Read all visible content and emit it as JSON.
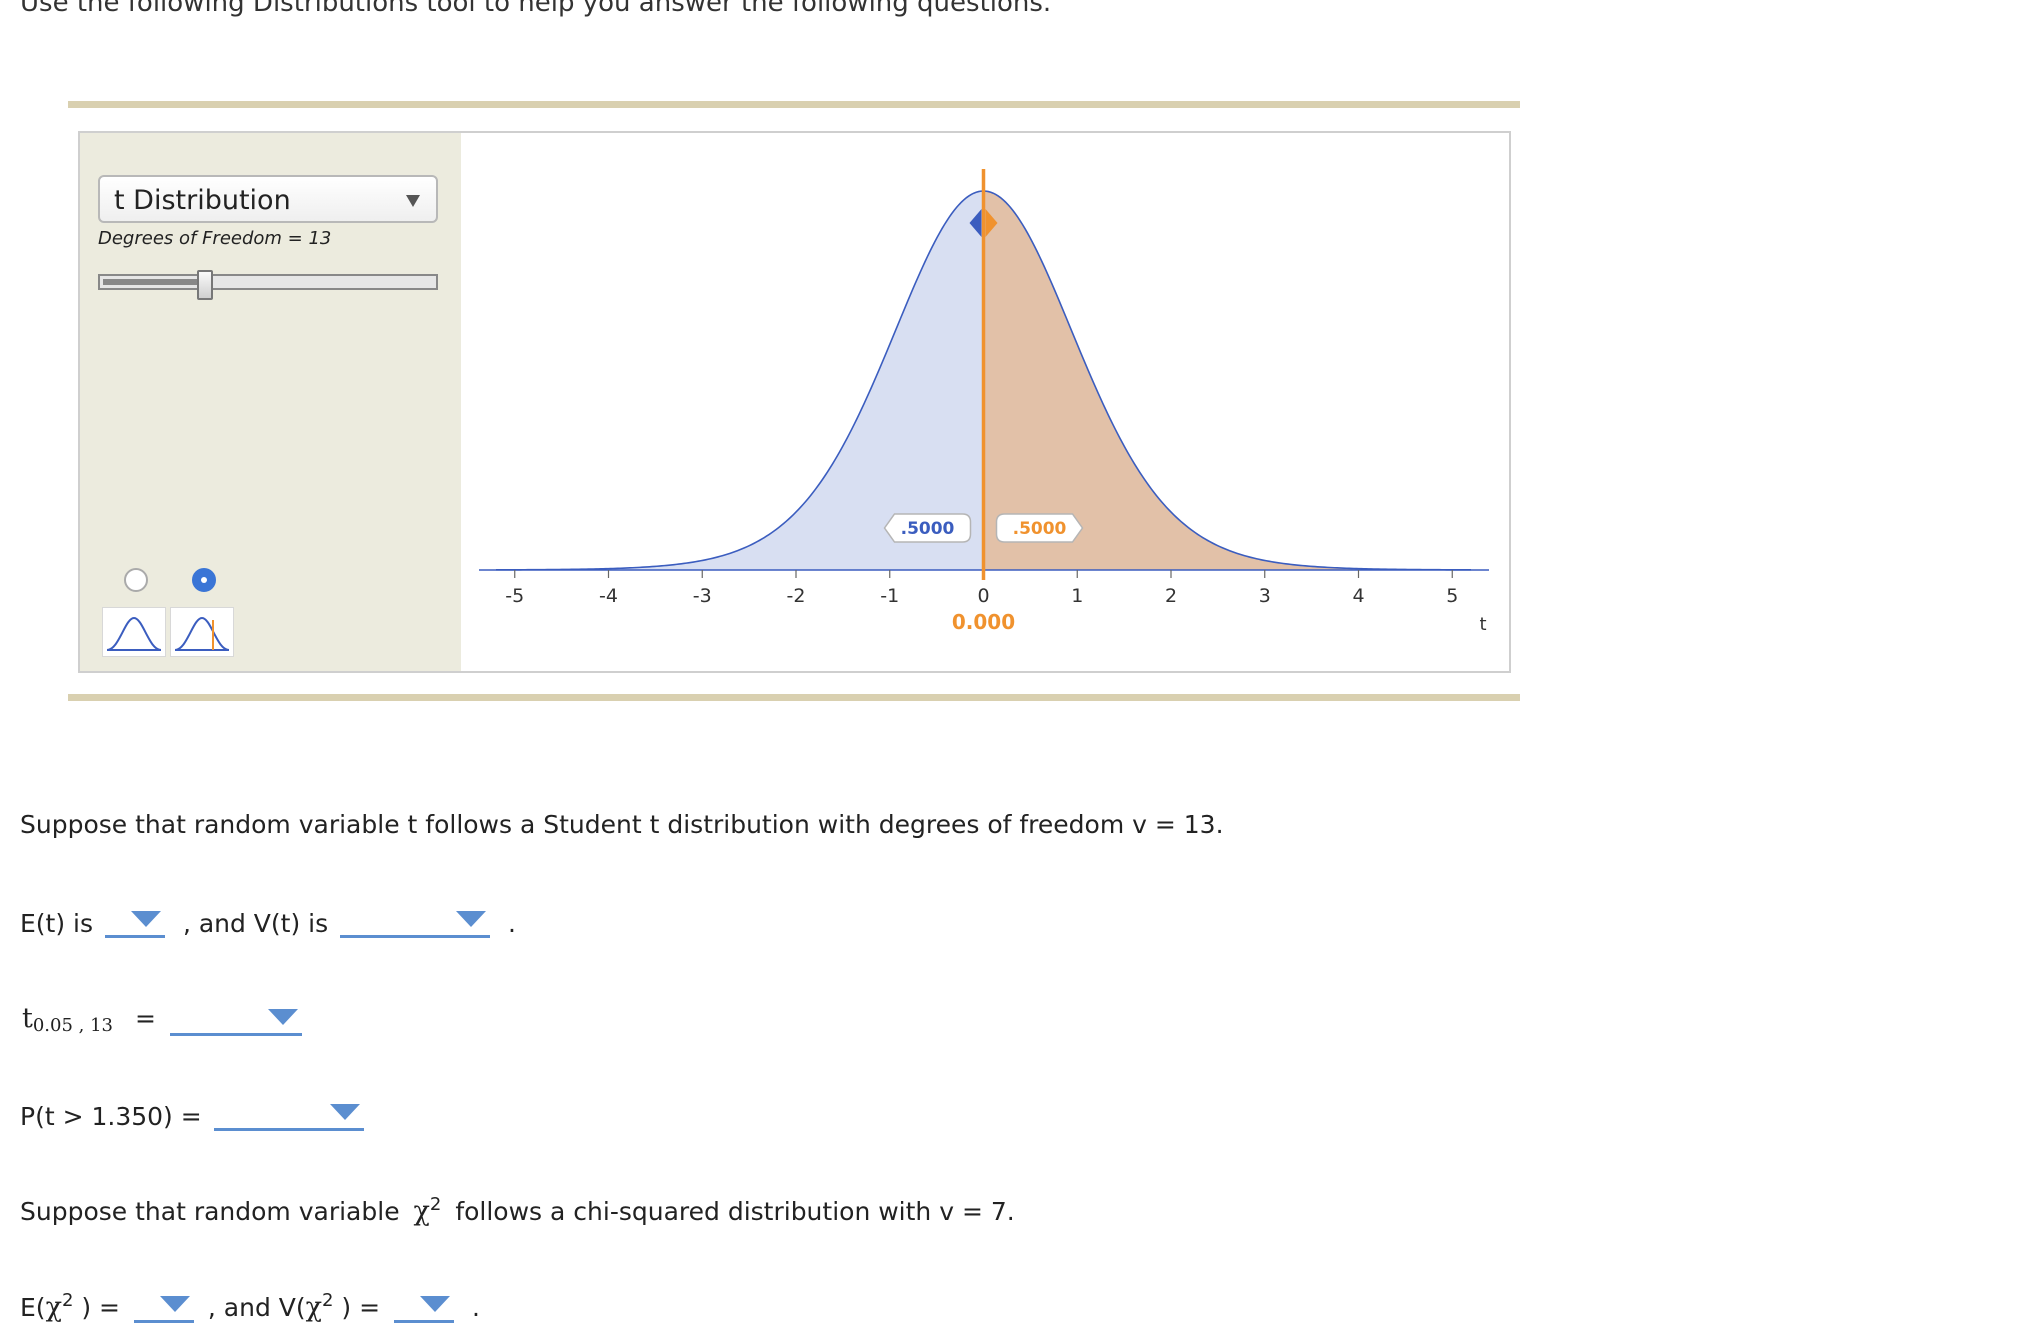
{
  "intro": "Use the following Distributions tool to help you answer the following questions.",
  "tool": {
    "distribution_select": {
      "value": "t Distribution"
    },
    "dof_label": "Degrees of Freedom = 13",
    "dof_slider": {
      "min": 1,
      "max": 40,
      "value": 13
    },
    "graph_modes": [
      {
        "name": "curve-only",
        "selected": false,
        "icon": "bell-curve-icon"
      },
      {
        "name": "curve-with-marker",
        "selected": true,
        "icon": "bell-curve-marker-icon"
      }
    ],
    "colors": {
      "left_area": "#d8dff2",
      "right_area": "#e2c1a8",
      "curve": "#3b5dbf",
      "marker": "#f0922e",
      "left_text": "#3b5dbf",
      "right_text": "#f0922e"
    }
  },
  "chart_data": {
    "type": "area",
    "distribution": "t",
    "degrees_of_freedom": 13,
    "x_ticks": [
      "-5",
      "-4",
      "-3",
      "-2",
      "-1",
      "0",
      "1",
      "2",
      "3",
      "4",
      "5"
    ],
    "xlim": [
      -5.2,
      5.2
    ],
    "xlabel": "t",
    "marker_value": "0.000",
    "left_area_label": ".5000",
    "right_area_label": ".5000"
  },
  "questions": {
    "intro_t": "Suppose that random variable t follows a Student t distribution with degrees of freedom v = 13.",
    "et_label": "E(t) is",
    "vt_label": ", and V(t) is",
    "period": ".",
    "t_crit_base": "t",
    "t_crit_sub": "0.05 , 13",
    "equals": "=",
    "prob_label": "P(t > 1.350) =",
    "intro_chi": "Suppose that random variable",
    "chi_symbol": "χ",
    "chi_exp": "2",
    "intro_chi_rest": "follows a chi-squared distribution with v = 7.",
    "e_chi_open": "E(",
    "e_chi_close": ") =",
    "v_chi_open": ", and V(",
    "v_chi_close": ") ="
  }
}
